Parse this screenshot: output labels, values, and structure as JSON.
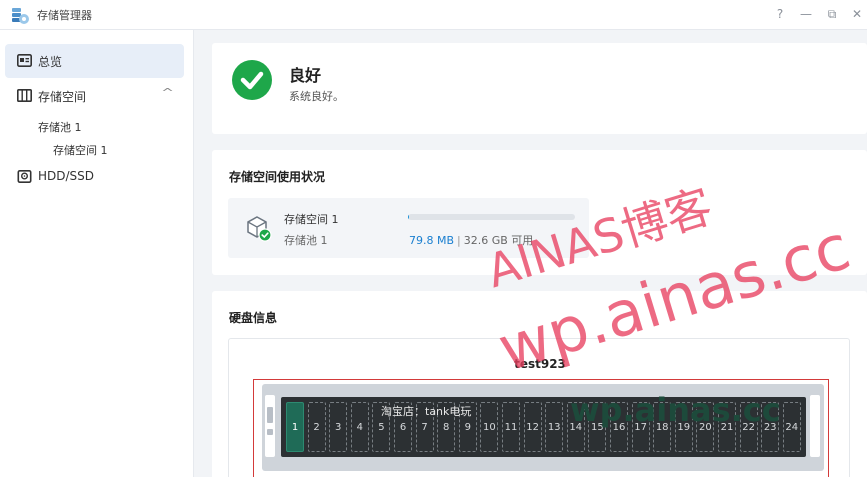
{
  "app": {
    "title": "存储管理器"
  },
  "window_controls": {
    "help": "?",
    "minimize": "—",
    "restore": "⧉",
    "close": "✕"
  },
  "sidebar": {
    "overview": "总览",
    "storage": "存储空间",
    "pool": "存储池 1",
    "volume": "存储空间 1",
    "hdd": "HDD/SSD"
  },
  "status": {
    "title": "良好",
    "subtitle": "系统良好。"
  },
  "usage_section": {
    "title": "存储空间使用状况",
    "volume_name": "存储空间 1",
    "pool_name": "存储池 1",
    "used": "79.8 MB",
    "separator": "|",
    "available": "32.6 GB 可用",
    "used_fraction": 0.0024
  },
  "disk_section": {
    "title": "硬盘信息",
    "host": "test923",
    "bays": [
      "1",
      "2",
      "3",
      "4",
      "5",
      "6",
      "7",
      "8",
      "9",
      "10",
      "11",
      "12",
      "13",
      "14",
      "15",
      "16",
      "17",
      "18",
      "19",
      "20",
      "21",
      "22",
      "23",
      "24"
    ],
    "filled_bays": [
      1
    ]
  },
  "watermarks": {
    "blog": "AINAS博客",
    "site": "wp.ainas.cc",
    "site2": "wp.ainas.cc",
    "shop": "淘宝店：tank电玩"
  },
  "colors": {
    "accent": "#1a8fd6",
    "success": "#1ea74a",
    "active_bay": "#1f6b57",
    "highlight_frame": "#d33a3a"
  }
}
